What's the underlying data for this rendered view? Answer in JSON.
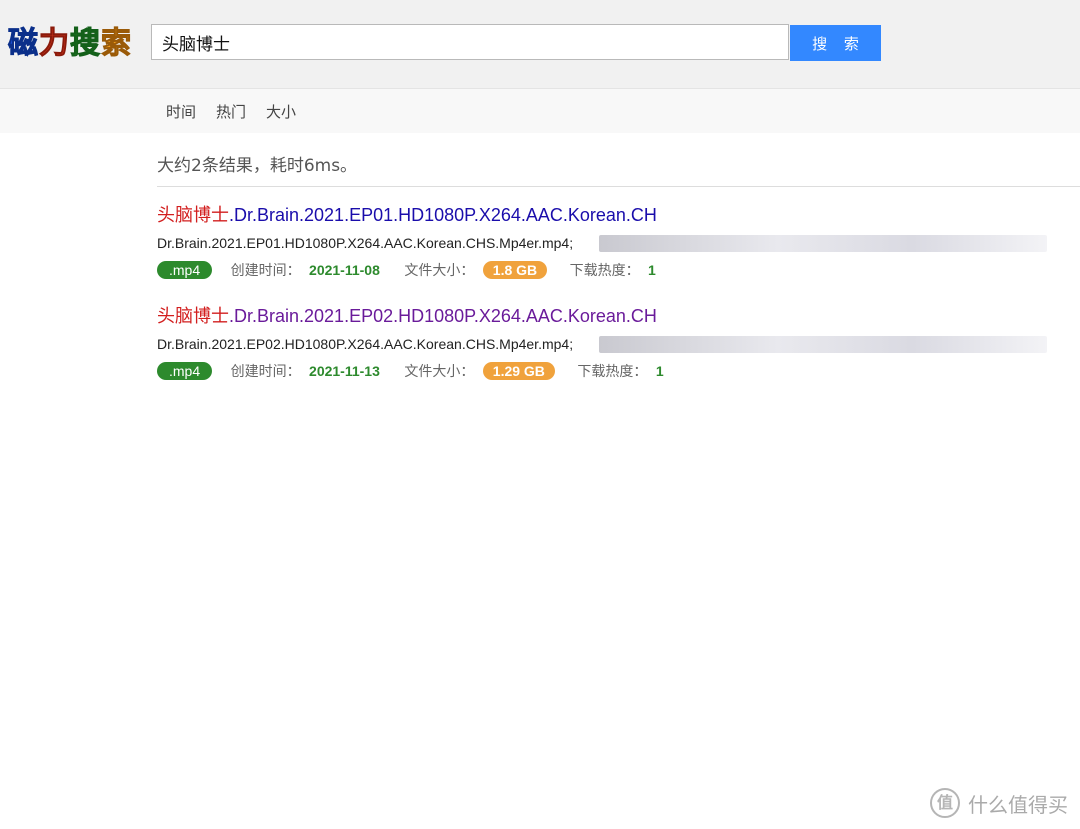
{
  "header": {
    "logo": [
      "磁",
      "力",
      "搜",
      "索"
    ],
    "search": {
      "value": "头脑博士",
      "placeholder": ""
    },
    "search_button_label": "搜 索"
  },
  "sortbar": {
    "items": [
      {
        "label": "时间"
      },
      {
        "label": "热门"
      },
      {
        "label": "大小"
      }
    ]
  },
  "summary": "大约2条结果，耗时6ms。",
  "results": [
    {
      "title_keyword": "头脑博士",
      "title_rest": ".Dr.Brain.2021.EP01.HD1080P.X264.AAC.Korean.CH",
      "file": "Dr.Brain.2021.EP01.HD1080P.X264.AAC.Korean.CHS.Mp4er.mp4;",
      "ext": ".mp4",
      "created_label": "创建时间：",
      "created": "2021-11-08",
      "size_label": "文件大小：",
      "size": "1.8 GB",
      "heat_label": "下载热度：",
      "heat": "1"
    },
    {
      "title_keyword": "头脑博士",
      "title_rest": ".Dr.Brain.2021.EP02.HD1080P.X264.AAC.Korean.CH",
      "file": "Dr.Brain.2021.EP02.HD1080P.X264.AAC.Korean.CHS.Mp4er.mp4;",
      "ext": ".mp4",
      "created_label": "创建时间：",
      "created": "2021-11-13",
      "size_label": "文件大小：",
      "size": "1.29 GB",
      "heat_label": "下载热度：",
      "heat": "1"
    }
  ],
  "watermark": {
    "icon_text": "值",
    "text": "什么值得买"
  },
  "colors": {
    "accent": "#3388ff",
    "keyword": "#d21e1e",
    "link": "#1a0dab",
    "visited_link": "#6a1b9a",
    "green": "#2d8a2d",
    "size_badge": "#f0a23c"
  }
}
